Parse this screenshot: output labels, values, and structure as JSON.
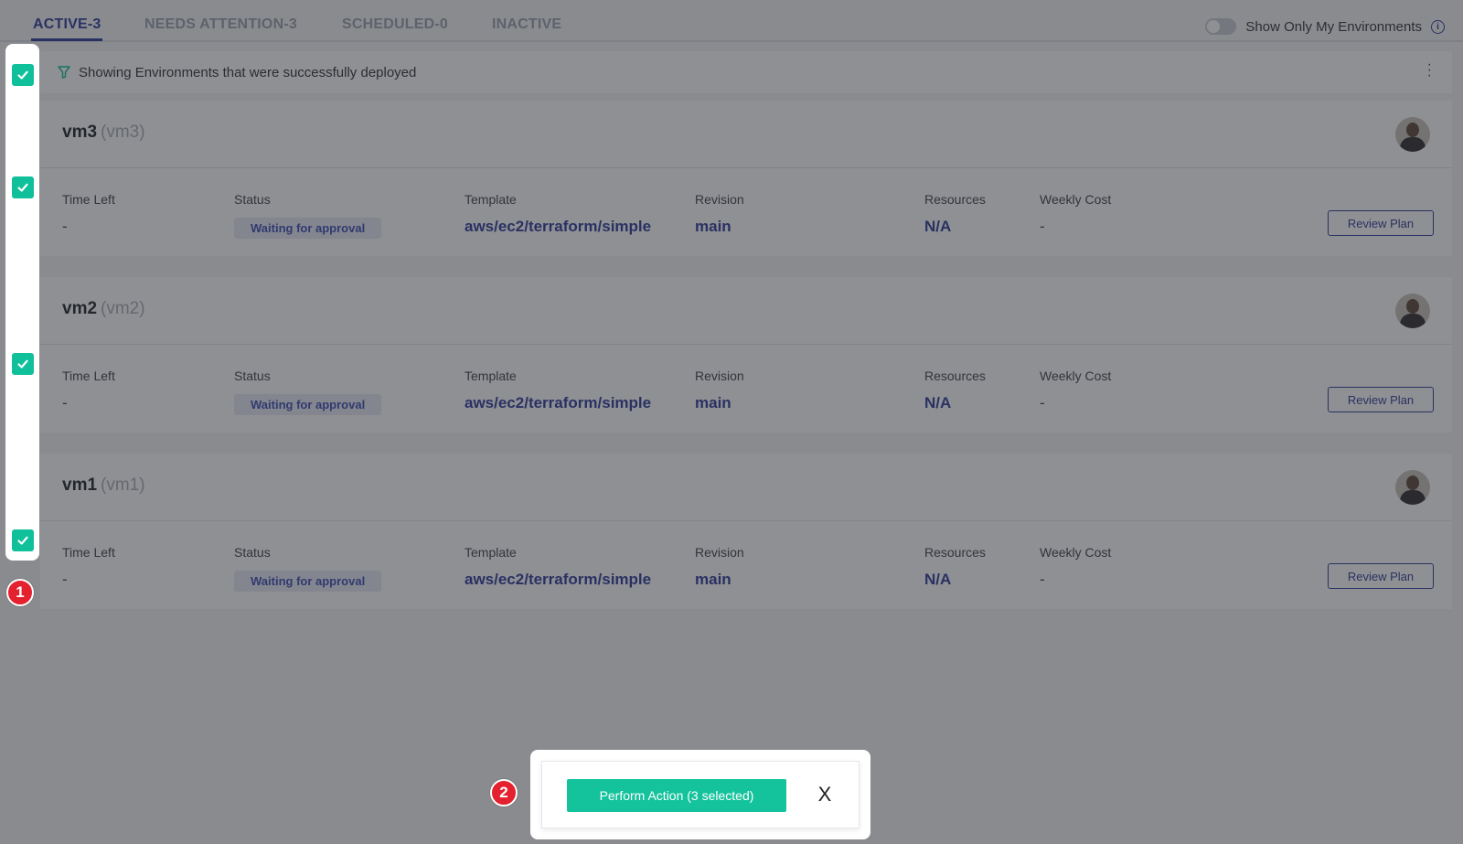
{
  "tabs": [
    {
      "label": "ACTIVE-3"
    },
    {
      "label": "NEEDS ATTENTION-3"
    },
    {
      "label": "SCHEDULED-0"
    },
    {
      "label": "INACTIVE"
    }
  ],
  "toggle": {
    "label": "Show Only My Environments"
  },
  "filter": {
    "text": "Showing Environments that were successfully deployed"
  },
  "columns": {
    "time_left": "Time Left",
    "status": "Status",
    "template": "Template",
    "revision": "Revision",
    "resources": "Resources",
    "weekly_cost": "Weekly Cost"
  },
  "environments": [
    {
      "name": "vm3",
      "id": "(vm3)",
      "time_left": "-",
      "status": "Waiting for approval",
      "template": "aws/ec2/terraform/simple",
      "revision": "main",
      "resources": "N/A",
      "weekly_cost": "-",
      "button": "Review Plan"
    },
    {
      "name": "vm2",
      "id": "(vm2)",
      "time_left": "-",
      "status": "Waiting for approval",
      "template": "aws/ec2/terraform/simple",
      "revision": "main",
      "resources": "N/A",
      "weekly_cost": "-",
      "button": "Review Plan"
    },
    {
      "name": "vm1",
      "id": "(vm1)",
      "time_left": "-",
      "status": "Waiting for approval",
      "template": "aws/ec2/terraform/simple",
      "revision": "main",
      "resources": "N/A",
      "weekly_cost": "-",
      "button": "Review Plan"
    }
  ],
  "steps": {
    "one": "1",
    "two": "2"
  },
  "action_bar": {
    "perform_label": "Perform Action (3 selected)",
    "close_label": "X"
  },
  "colors": {
    "accent": "#2b3a9b",
    "checkbox": "#10c09a",
    "primary_button": "#14c39c",
    "step_badge": "#e4212e"
  },
  "icons": {
    "filter": "filter-icon",
    "info": "info-icon",
    "check": "checkmark-icon",
    "more": "kebab-menu-icon"
  }
}
